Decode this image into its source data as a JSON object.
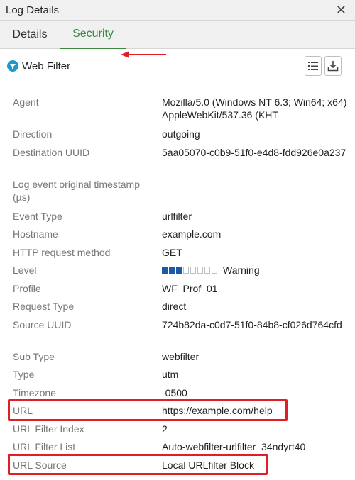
{
  "window": {
    "title": "Log Details",
    "close_icon": "close-icon"
  },
  "tabs": [
    {
      "label": "Details",
      "active": false
    },
    {
      "label": "Security",
      "active": true
    }
  ],
  "accent_color": "#3b8a3e",
  "annotation_color": "#e01e26",
  "section": {
    "title": "Web Filter",
    "icon": "filter-icon",
    "tools": [
      "list-icon",
      "download-icon"
    ]
  },
  "rows": [
    {
      "label": "Agent",
      "value": "Mozilla/5.0 (Windows NT 6.3; Win64; x64) AppleWebKit/537.36 (KHT"
    },
    {
      "label": "Direction",
      "value": "outgoing"
    },
    {
      "label": "Destination UUID",
      "value": "5aa05070-c0b9-51f0-e4d8-fdd926e0a237"
    },
    {
      "label": "Log event original timestamp (µs)",
      "value": ""
    },
    {
      "label": "Event Type",
      "value": "urlfilter"
    },
    {
      "label": "Hostname",
      "value": "example.com"
    },
    {
      "label": "HTTP request method",
      "value": "GET"
    },
    {
      "label": "Level",
      "value": "Warning",
      "level": {
        "filled": 3,
        "total": 8
      }
    },
    {
      "label": "Profile",
      "value": "WF_Prof_01"
    },
    {
      "label": "Request Type",
      "value": "direct"
    },
    {
      "label": "Source UUID",
      "value": "724b82da-c0d7-51f0-84b8-cf026d764cfd"
    },
    {
      "label": "Sub Type",
      "value": "webfilter"
    },
    {
      "label": "Type",
      "value": "utm"
    },
    {
      "label": "Timezone",
      "value": "-0500"
    },
    {
      "label": "URL",
      "value": "https://example.com/help"
    },
    {
      "label": "URL Filter Index",
      "value": "2"
    },
    {
      "label": "URL Filter List",
      "value": "Auto-webfilter-urlfilter_34ndyrt40"
    },
    {
      "label": "URL Source",
      "value": "Local URLfilter Block"
    }
  ]
}
